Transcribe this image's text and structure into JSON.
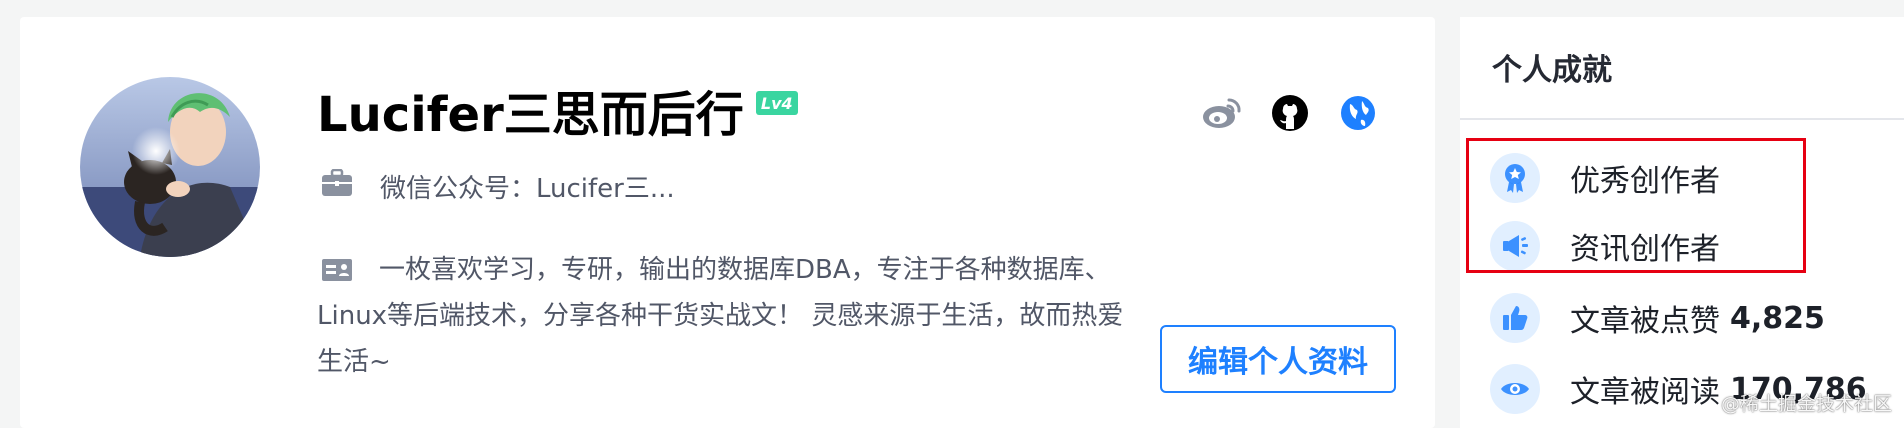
{
  "profile": {
    "name": "Lucifer三思而后行",
    "level": "Lv4",
    "job": "微信公众号：Lucifer三...",
    "bio": "一枚喜欢学习，专研，输出的数据库DBA，专注于各种数据库、Linux等后端技术，分享各种干货实战文！ 灵感来源于生活，故而热爱生活~",
    "edit_button": "编辑个人资料"
  },
  "social": [
    {
      "icon": "weibo-icon"
    },
    {
      "icon": "github-icon"
    },
    {
      "icon": "website-icon"
    }
  ],
  "achievements": {
    "title": "个人成就",
    "items": [
      {
        "icon": "medal-icon",
        "label": "优秀创作者",
        "count": ""
      },
      {
        "icon": "megaphone-icon",
        "label": "资讯创作者",
        "count": ""
      },
      {
        "icon": "thumbs-up-icon",
        "label": "文章被点赞",
        "count": "4,825"
      },
      {
        "icon": "eye-icon",
        "label": "文章被阅读",
        "count": "170,786"
      }
    ]
  },
  "watermark": "@稀土掘金技术社区",
  "colors": {
    "accent": "#1e80ff",
    "level_badge": "#3ad5a0",
    "highlight": "#e60012",
    "icon_bg": "#e1efff"
  }
}
